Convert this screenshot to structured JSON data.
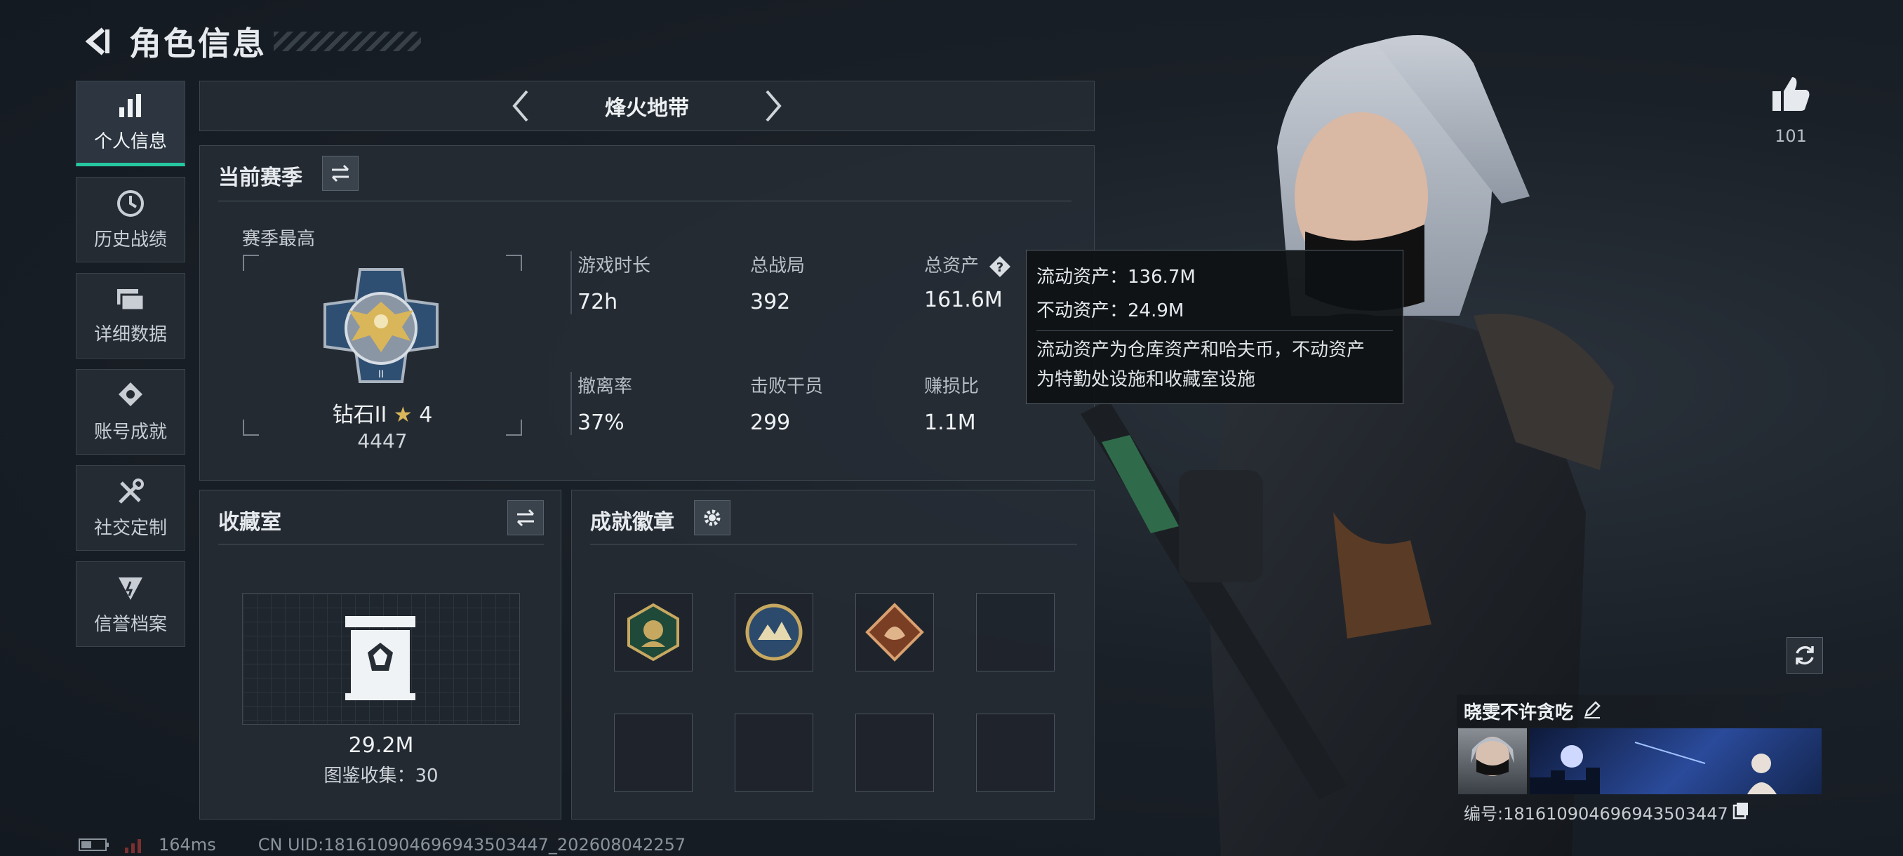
{
  "header": {
    "title": "角色信息"
  },
  "sidebar": {
    "items": [
      {
        "label": "个人信息"
      },
      {
        "label": "历史战绩"
      },
      {
        "label": "详细数据"
      },
      {
        "label": "账号成就"
      },
      {
        "label": "社交定制"
      },
      {
        "label": "信誉档案"
      }
    ]
  },
  "mode": {
    "name": "烽火地带"
  },
  "season": {
    "title": "当前赛季",
    "best_label": "赛季最高",
    "rank_name": "钻石II",
    "rank_stars": "4",
    "rank_points": "4447",
    "stats": [
      {
        "label": "游戏时长",
        "value": "72h"
      },
      {
        "label": "总战局",
        "value": "392"
      },
      {
        "label": "总资产",
        "value": "161.6M"
      },
      {
        "label": "撤离率",
        "value": "37%"
      },
      {
        "label": "击败干员",
        "value": "299"
      },
      {
        "label": "赚损比",
        "value": "1.1M"
      }
    ]
  },
  "tooltip": {
    "liquid": "流动资产：136.7M",
    "fixed": "不动资产：24.9M",
    "desc_line1": "流动资产为仓库资产和哈夫币，不动资产",
    "desc_line2": "为特勤处设施和收藏室设施"
  },
  "collection": {
    "title": "收藏室",
    "value": "29.2M",
    "catalog": "图鉴收集：30"
  },
  "achievements": {
    "title": "成就徽章"
  },
  "likes": {
    "count": "101"
  },
  "profile": {
    "name": "晓雯不许贪吃",
    "id_text": "编号:1816109046969435034​47"
  },
  "status": {
    "ping": "164ms",
    "uid": "CN UID:18161090469694350​3447_202608042257"
  },
  "colors": {
    "accent": "#26c7a0",
    "background": "#1a2027",
    "panel": "#262d35"
  }
}
